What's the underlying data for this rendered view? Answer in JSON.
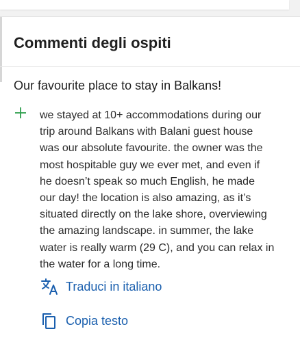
{
  "section": {
    "title": "Commenti degli ospiti"
  },
  "review": {
    "title": "Our favourite place to stay in Balkans!",
    "body": "we stayed at 10+ accommodations during our\ntrip around Balkans with Balani guest house\nwas our absolute favourite. the owner was the\nmost hospitable guy we ever met, and even if\nhe doesn’t speak so much English, he made\nour day! the location is also amazing, as it’s\nsituated directly on the lake shore, overviewing\nthe amazing landscape. in summer, the lake\nwater is really warm (29 C), and you can relax in\nthe water for a long time.",
    "type_icon": "plus-icon"
  },
  "actions": {
    "translate": {
      "label": "Traduci in italiano",
      "icon": "translate-icon"
    },
    "copy": {
      "label": "Copia testo",
      "icon": "copy-icon"
    }
  },
  "colors": {
    "positive": "#2e9e4d",
    "link": "#1a5fae",
    "text": "#1f1f1f"
  }
}
